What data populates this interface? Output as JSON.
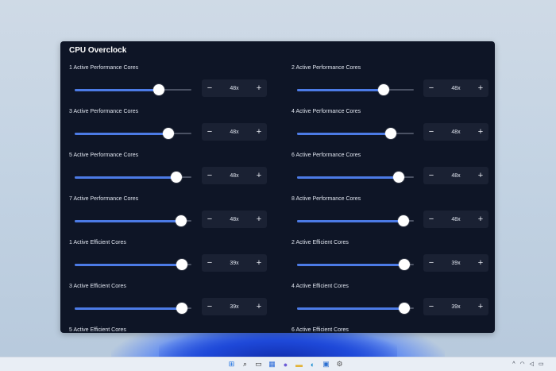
{
  "panel": {
    "title": "CPU Overclock"
  },
  "controls": [
    {
      "label": "1 Active Performance Cores",
      "value": "48x",
      "level": 0.72
    },
    {
      "label": "2 Active Performance Cores",
      "value": "48x",
      "level": 0.74
    },
    {
      "label": "3 Active Performance Cores",
      "value": "48x",
      "level": 0.8
    },
    {
      "label": "4 Active Performance Cores",
      "value": "48x",
      "level": 0.8
    },
    {
      "label": "5 Active Performance Cores",
      "value": "48x",
      "level": 0.87
    },
    {
      "label": "6 Active Performance Cores",
      "value": "48x",
      "level": 0.87
    },
    {
      "label": "7 Active Performance Cores",
      "value": "48x",
      "level": 0.91
    },
    {
      "label": "8 Active Performance Cores",
      "value": "48x",
      "level": 0.91
    },
    {
      "label": "1 Active Efficient Cores",
      "value": "39x",
      "level": 0.92
    },
    {
      "label": "2 Active Efficient Cores",
      "value": "39x",
      "level": 0.92
    },
    {
      "label": "3 Active Efficient Cores",
      "value": "39x",
      "level": 0.92
    },
    {
      "label": "4 Active Efficient Cores",
      "value": "39x",
      "level": 0.92
    },
    {
      "label": "5 Active Efficient Cores",
      "value": "",
      "level": null
    },
    {
      "label": "6 Active Efficient Cores",
      "value": "",
      "level": null
    }
  ],
  "stepper": {
    "minus": "−",
    "plus": "+"
  },
  "taskbar": {
    "icons": [
      "windows-start-icon",
      "search-icon",
      "task-view-icon",
      "widgets-icon",
      "chat-icon",
      "file-explorer-icon",
      "edge-icon",
      "store-icon",
      "settings-icon"
    ],
    "colors": {
      "accent": "#4c7be6",
      "panel": "#0e1526",
      "stepper": "#1a2133"
    }
  }
}
